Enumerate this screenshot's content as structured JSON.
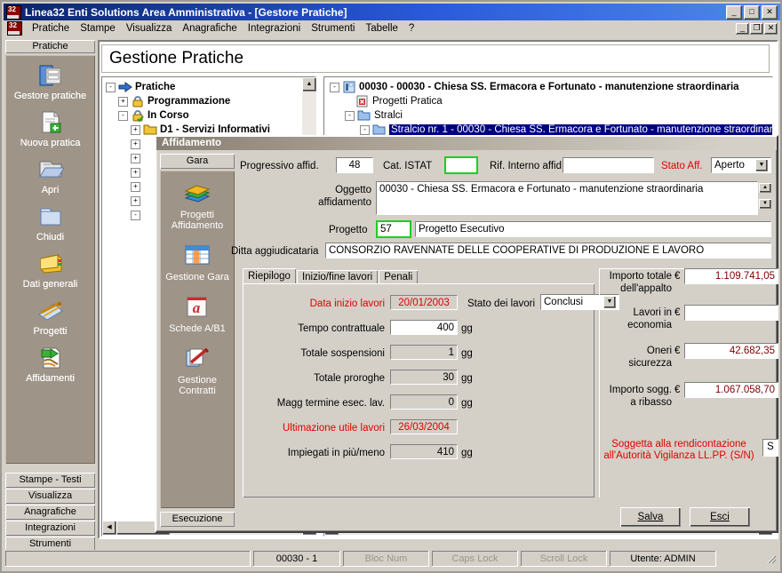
{
  "window": {
    "title": "Linea32 Enti Solutions Area Amministrativa - [Gestore Pratiche]",
    "app_icon": "app-logo-icon",
    "controls": [
      "minimize-icon",
      "maximize-icon",
      "close-icon"
    ],
    "mdi_controls": [
      "mdi-minimize-icon",
      "mdi-restore-icon",
      "mdi-close-icon"
    ]
  },
  "menu": {
    "items": [
      "Pratiche",
      "Stampe",
      "Visualizza",
      "Anagrafiche",
      "Integrazioni",
      "Strumenti",
      "Tabelle",
      "?"
    ]
  },
  "sidebar": {
    "header": "Pratiche",
    "items": [
      {
        "label": "Gestore pratiche",
        "icon": "folder-cabinet-icon"
      },
      {
        "label": "Nuova pratica",
        "icon": "new-document-icon"
      },
      {
        "label": "Apri",
        "icon": "open-folder-icon"
      },
      {
        "label": "Chiudi",
        "icon": "closed-folder-icon"
      },
      {
        "label": "Dati generali",
        "icon": "yellow-book-icon"
      },
      {
        "label": "Progetti",
        "icon": "drafting-tools-icon"
      },
      {
        "label": "Affidamenti",
        "icon": "document-handover-icon"
      }
    ],
    "buttons": [
      "Stampe - Testi",
      "Visualizza",
      "Anagrafiche",
      "Integrazioni",
      "Strumenti"
    ]
  },
  "main": {
    "page_title": "Gestione Pratiche"
  },
  "tree_left": {
    "nodes": [
      {
        "label": "Pratiche",
        "toggle": "-",
        "icon": "blue-arrow-icon",
        "bold": true,
        "indent": 0
      },
      {
        "label": "Programmazione",
        "toggle": "+",
        "icon": "padlock-icon",
        "bold": true,
        "indent": 1
      },
      {
        "label": "In Corso",
        "toggle": "-",
        "icon": "padlock-check-icon",
        "bold": true,
        "indent": 1
      },
      {
        "label": "D1 - Servizi Informativi",
        "toggle": "+",
        "icon": "folder-icon",
        "bold": true,
        "indent": 2
      }
    ],
    "hidden_toggles": [
      "+",
      "+",
      "+",
      "+",
      "+",
      "-"
    ]
  },
  "tree_right": {
    "nodes": [
      {
        "label": "00030 - 00030 - Chiesa SS. Ermacora e Fortunato - manutenzione straordinaria",
        "toggle": "-",
        "icon": "practice-icon",
        "bold": true,
        "indent": 0,
        "selected": false
      },
      {
        "label": "Progetti Pratica",
        "toggle": "",
        "icon": "red-x-document-icon",
        "bold": false,
        "indent": 1,
        "selected": false
      },
      {
        "label": "Stralci",
        "toggle": "-",
        "icon": "blue-folder-icon",
        "bold": false,
        "indent": 1,
        "selected": false
      },
      {
        "label": "Stralcio nr. 1 - 00030 - Chiesa SS. Ermacora e Fortunato - manutenzione straordinaria",
        "toggle": "-",
        "icon": "blue-folder-icon",
        "bold": false,
        "indent": 2,
        "selected": true
      }
    ]
  },
  "dialog": {
    "title": "Affidamento",
    "left_panel": {
      "top_button": "Gara",
      "items": [
        {
          "label": "Progetti Affidamento",
          "icon": "stacked-books-icon"
        },
        {
          "label": "Gestione Gara",
          "icon": "spreadsheet-icon"
        },
        {
          "label": "Schede A/B1",
          "icon": "red-a-card-icon"
        },
        {
          "label": "Gestione Contratti",
          "icon": "sign-contract-icon"
        }
      ],
      "bottom_button": "Esecuzione"
    },
    "fields": {
      "progressivo_label": "Progressivo affid.",
      "progressivo_value": "48",
      "cat_istat_label": "Cat. ISTAT",
      "cat_istat_value": "",
      "rif_interno_label": "Rif. Interno affid.",
      "rif_interno_value": "",
      "stato_aff_label": "Stato Aff.",
      "stato_aff_value": "Aperto",
      "oggetto_label_1": "Oggetto",
      "oggetto_label_2": "affidamento",
      "oggetto_value": "00030 - Chiesa SS. Ermacora e Fortunato - manutenzione straordinaria",
      "progetto_label": "Progetto",
      "progetto_code": "57",
      "progetto_desc": "Progetto Esecutivo",
      "ditta_label": "Ditta aggiudicataria",
      "ditta_value": "CONSORZIO RAVENNATE DELLE COOPERATIVE DI PRODUZIONE E LAVORO"
    },
    "tabs": [
      {
        "label": "Riepilogo",
        "active": true
      },
      {
        "label": "Inizio/fine lavori",
        "active": false
      },
      {
        "label": "Penali",
        "active": false
      }
    ],
    "riepilogo": {
      "rows": [
        {
          "label": "Data inizio lavori",
          "value": "20/01/2003",
          "unit": "",
          "red": true,
          "readonly": true
        },
        {
          "label": "Tempo contrattuale",
          "value": "400",
          "unit": "gg",
          "red": false,
          "readonly": false
        },
        {
          "label": "Totale sospensioni",
          "value": "1",
          "unit": "gg",
          "red": false,
          "readonly": true
        },
        {
          "label": "Totale proroghe",
          "value": "30",
          "unit": "gg",
          "red": false,
          "readonly": true
        },
        {
          "label": "Magg termine esec. lav.",
          "value": "0",
          "unit": "gg",
          "red": false,
          "readonly": true
        },
        {
          "label": "Ultimazione utile lavori",
          "value": "26/03/2004",
          "unit": "",
          "red": true,
          "readonly": true
        },
        {
          "label": "Impiegati in più/meno",
          "value": "410",
          "unit": "gg",
          "red": false,
          "readonly": true
        }
      ],
      "stato_lavori_label": "Stato dei lavori",
      "stato_lavori_value": "Conclusi"
    },
    "amounts": [
      {
        "label_1": "Importo totale",
        "label_2": "dell'appalto",
        "currency": "€",
        "value": "1.109.741,05"
      },
      {
        "label_1": "Lavori in",
        "label_2": "economia",
        "currency": "€",
        "value": ""
      },
      {
        "label_1": "Oneri",
        "label_2": "sicurezza",
        "currency": "€",
        "value": "42.682,35"
      },
      {
        "label_1": "Importo sogg.",
        "label_2": "a ribasso",
        "currency": "€",
        "value": "1.067.058,70"
      }
    ],
    "rendicontazione": {
      "line1": "Soggetta alla rendicontazione",
      "line2": "all'Autorità Vigilanza LL.PP. (S/N)",
      "value": "S"
    },
    "buttons": {
      "save": "Salva",
      "exit": "Esci"
    }
  },
  "statusbar": {
    "panels": [
      {
        "text": "00030 - 1",
        "dim": false
      },
      {
        "text": "Bloc Num",
        "dim": true
      },
      {
        "text": "Caps Lock",
        "dim": true
      },
      {
        "text": "Scroll Lock",
        "dim": true
      },
      {
        "text": "Utente: ADMIN",
        "dim": false
      }
    ]
  },
  "colors": {
    "titlebar_start": "#0a246a",
    "face": "#d4d0c8",
    "panel_brown": "#9f9488",
    "selection": "#000080",
    "red_label": "#e00000",
    "amount_text": "#7a0000",
    "green_border": "#22cc22"
  }
}
